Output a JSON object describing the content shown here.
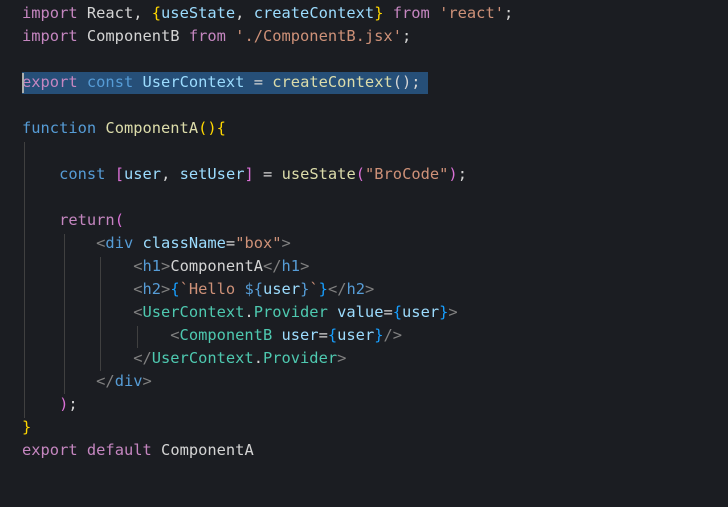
{
  "editor": {
    "background": "#1b1d22",
    "selection_color": "#264f78",
    "selected_line": 4,
    "lines": [
      [
        {
          "t": "import",
          "c": "kw-ctrl"
        },
        {
          "t": " React, ",
          "c": "plain"
        },
        {
          "t": "{",
          "c": "bracket-gold"
        },
        {
          "t": "useState",
          "c": "var"
        },
        {
          "t": ", ",
          "c": "plain"
        },
        {
          "t": "createContext",
          "c": "var"
        },
        {
          "t": "}",
          "c": "bracket-gold"
        },
        {
          "t": " ",
          "c": "plain"
        },
        {
          "t": "from",
          "c": "kw-ctrl"
        },
        {
          "t": " ",
          "c": "plain"
        },
        {
          "t": "'react'",
          "c": "str"
        },
        {
          "t": ";",
          "c": "plain"
        }
      ],
      [
        {
          "t": "import",
          "c": "kw-ctrl"
        },
        {
          "t": " ComponentB ",
          "c": "plain"
        },
        {
          "t": "from",
          "c": "kw-ctrl"
        },
        {
          "t": " ",
          "c": "plain"
        },
        {
          "t": "'./ComponentB.jsx'",
          "c": "str"
        },
        {
          "t": ";",
          "c": "plain"
        }
      ],
      [],
      [
        {
          "t": "export",
          "c": "kw-ctrl"
        },
        {
          "t": " ",
          "c": "plain"
        },
        {
          "t": "const",
          "c": "kw"
        },
        {
          "t": " ",
          "c": "plain"
        },
        {
          "t": "UserContext",
          "c": "var"
        },
        {
          "t": " = ",
          "c": "plain"
        },
        {
          "t": "createContext",
          "c": "fn"
        },
        {
          "t": "();",
          "c": "plain"
        }
      ],
      [],
      [
        {
          "t": "function",
          "c": "kw"
        },
        {
          "t": " ",
          "c": "plain"
        },
        {
          "t": "ComponentA",
          "c": "fn"
        },
        {
          "t": "()",
          "c": "bracket-gold"
        },
        {
          "t": "{",
          "c": "bracket-gold"
        }
      ],
      [],
      [
        {
          "t": "    ",
          "c": "plain"
        },
        {
          "t": "const",
          "c": "kw"
        },
        {
          "t": " ",
          "c": "plain"
        },
        {
          "t": "[",
          "c": "bracket-pink"
        },
        {
          "t": "user",
          "c": "var"
        },
        {
          "t": ", ",
          "c": "plain"
        },
        {
          "t": "setUser",
          "c": "var"
        },
        {
          "t": "]",
          "c": "bracket-pink"
        },
        {
          "t": " = ",
          "c": "plain"
        },
        {
          "t": "useState",
          "c": "fn"
        },
        {
          "t": "(",
          "c": "bracket-pink"
        },
        {
          "t": "\"BroCode\"",
          "c": "str"
        },
        {
          "t": ")",
          "c": "bracket-pink"
        },
        {
          "t": ";",
          "c": "plain"
        }
      ],
      [],
      [
        {
          "t": "    ",
          "c": "plain"
        },
        {
          "t": "return",
          "c": "kw-ctrl"
        },
        {
          "t": "(",
          "c": "bracket-pink"
        }
      ],
      [
        {
          "t": "        ",
          "c": "plain"
        },
        {
          "t": "<",
          "c": "tag-punct"
        },
        {
          "t": "div",
          "c": "tag"
        },
        {
          "t": " ",
          "c": "plain"
        },
        {
          "t": "className",
          "c": "var"
        },
        {
          "t": "=",
          "c": "plain"
        },
        {
          "t": "\"box\"",
          "c": "str"
        },
        {
          "t": ">",
          "c": "tag-punct"
        }
      ],
      [
        {
          "t": "            ",
          "c": "plain"
        },
        {
          "t": "<",
          "c": "tag-punct"
        },
        {
          "t": "h1",
          "c": "tag"
        },
        {
          "t": ">",
          "c": "tag-punct"
        },
        {
          "t": "ComponentA",
          "c": "plain"
        },
        {
          "t": "</",
          "c": "tag-punct"
        },
        {
          "t": "h1",
          "c": "tag"
        },
        {
          "t": ">",
          "c": "tag-punct"
        }
      ],
      [
        {
          "t": "            ",
          "c": "plain"
        },
        {
          "t": "<",
          "c": "tag-punct"
        },
        {
          "t": "h2",
          "c": "tag"
        },
        {
          "t": ">",
          "c": "tag-punct"
        },
        {
          "t": "{",
          "c": "bracket-blue"
        },
        {
          "t": "`Hello ",
          "c": "str"
        },
        {
          "t": "${",
          "c": "kw"
        },
        {
          "t": "user",
          "c": "var"
        },
        {
          "t": "}",
          "c": "kw"
        },
        {
          "t": "`",
          "c": "str"
        },
        {
          "t": "}",
          "c": "bracket-blue"
        },
        {
          "t": "</",
          "c": "tag-punct"
        },
        {
          "t": "h2",
          "c": "tag"
        },
        {
          "t": ">",
          "c": "tag-punct"
        }
      ],
      [
        {
          "t": "            ",
          "c": "plain"
        },
        {
          "t": "<",
          "c": "tag-punct"
        },
        {
          "t": "UserContext",
          "c": "comp"
        },
        {
          "t": ".",
          "c": "plain"
        },
        {
          "t": "Provider",
          "c": "comp"
        },
        {
          "t": " ",
          "c": "plain"
        },
        {
          "t": "value",
          "c": "var"
        },
        {
          "t": "=",
          "c": "plain"
        },
        {
          "t": "{",
          "c": "bracket-blue"
        },
        {
          "t": "user",
          "c": "var"
        },
        {
          "t": "}",
          "c": "bracket-blue"
        },
        {
          "t": ">",
          "c": "tag-punct"
        }
      ],
      [
        {
          "t": "                ",
          "c": "plain"
        },
        {
          "t": "<",
          "c": "tag-punct"
        },
        {
          "t": "ComponentB",
          "c": "comp"
        },
        {
          "t": " ",
          "c": "plain"
        },
        {
          "t": "user",
          "c": "var"
        },
        {
          "t": "=",
          "c": "plain"
        },
        {
          "t": "{",
          "c": "bracket-blue"
        },
        {
          "t": "user",
          "c": "var"
        },
        {
          "t": "}",
          "c": "bracket-blue"
        },
        {
          "t": "/>",
          "c": "tag-punct"
        }
      ],
      [
        {
          "t": "            ",
          "c": "plain"
        },
        {
          "t": "</",
          "c": "tag-punct"
        },
        {
          "t": "UserContext",
          "c": "comp"
        },
        {
          "t": ".",
          "c": "plain"
        },
        {
          "t": "Provider",
          "c": "comp"
        },
        {
          "t": ">",
          "c": "tag-punct"
        }
      ],
      [
        {
          "t": "        ",
          "c": "plain"
        },
        {
          "t": "</",
          "c": "tag-punct"
        },
        {
          "t": "div",
          "c": "tag"
        },
        {
          "t": ">",
          "c": "tag-punct"
        }
      ],
      [
        {
          "t": "    ",
          "c": "plain"
        },
        {
          "t": ")",
          "c": "bracket-pink"
        },
        {
          "t": ";",
          "c": "plain"
        }
      ],
      [
        {
          "t": "}",
          "c": "bracket-gold"
        }
      ],
      [
        {
          "t": "export",
          "c": "kw-ctrl"
        },
        {
          "t": " ",
          "c": "plain"
        },
        {
          "t": "default",
          "c": "kw-ctrl"
        },
        {
          "t": " ",
          "c": "plain"
        },
        {
          "t": "ComponentA",
          "c": "plain"
        }
      ]
    ]
  }
}
